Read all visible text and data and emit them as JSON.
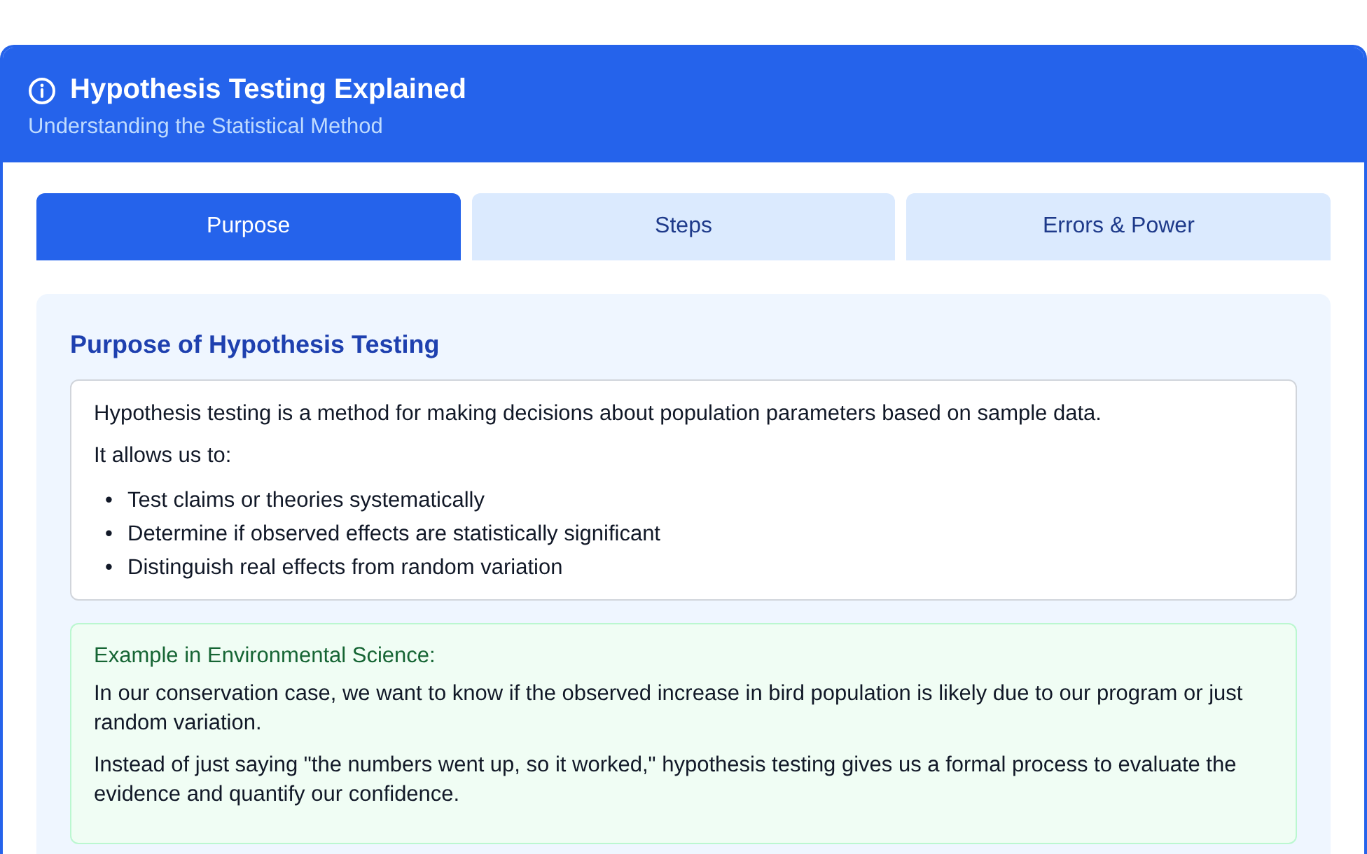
{
  "header": {
    "title": "Hypothesis Testing Explained",
    "subtitle": "Understanding the Statistical Method"
  },
  "tabs": [
    {
      "label": "Purpose",
      "selected": true
    },
    {
      "label": "Steps",
      "selected": false
    },
    {
      "label": "Errors & Power",
      "selected": false
    }
  ],
  "section": {
    "title": "Purpose of Hypothesis Testing",
    "intro": "Hypothesis testing is a method for making decisions about population parameters based on sample data.",
    "lead": "It allows us to:",
    "bullets": [
      {
        "marker": "•",
        "text": "Test claims or theories systematically"
      },
      {
        "marker": "•",
        "text": "Determine if observed effects are statistically significant"
      },
      {
        "marker": "•",
        "text": "Distinguish real effects from random variation"
      }
    ],
    "example": {
      "title": "Example in Environmental Science:",
      "paragraphs": [
        "In our conservation case, we want to know if the observed increase in bird population is likely due to our program or just random variation.",
        "Instead of just saying \"the numbers went up, so it worked,\" hypothesis testing gives us a formal process to evaluate the evidence and quantify our confidence."
      ]
    }
  }
}
